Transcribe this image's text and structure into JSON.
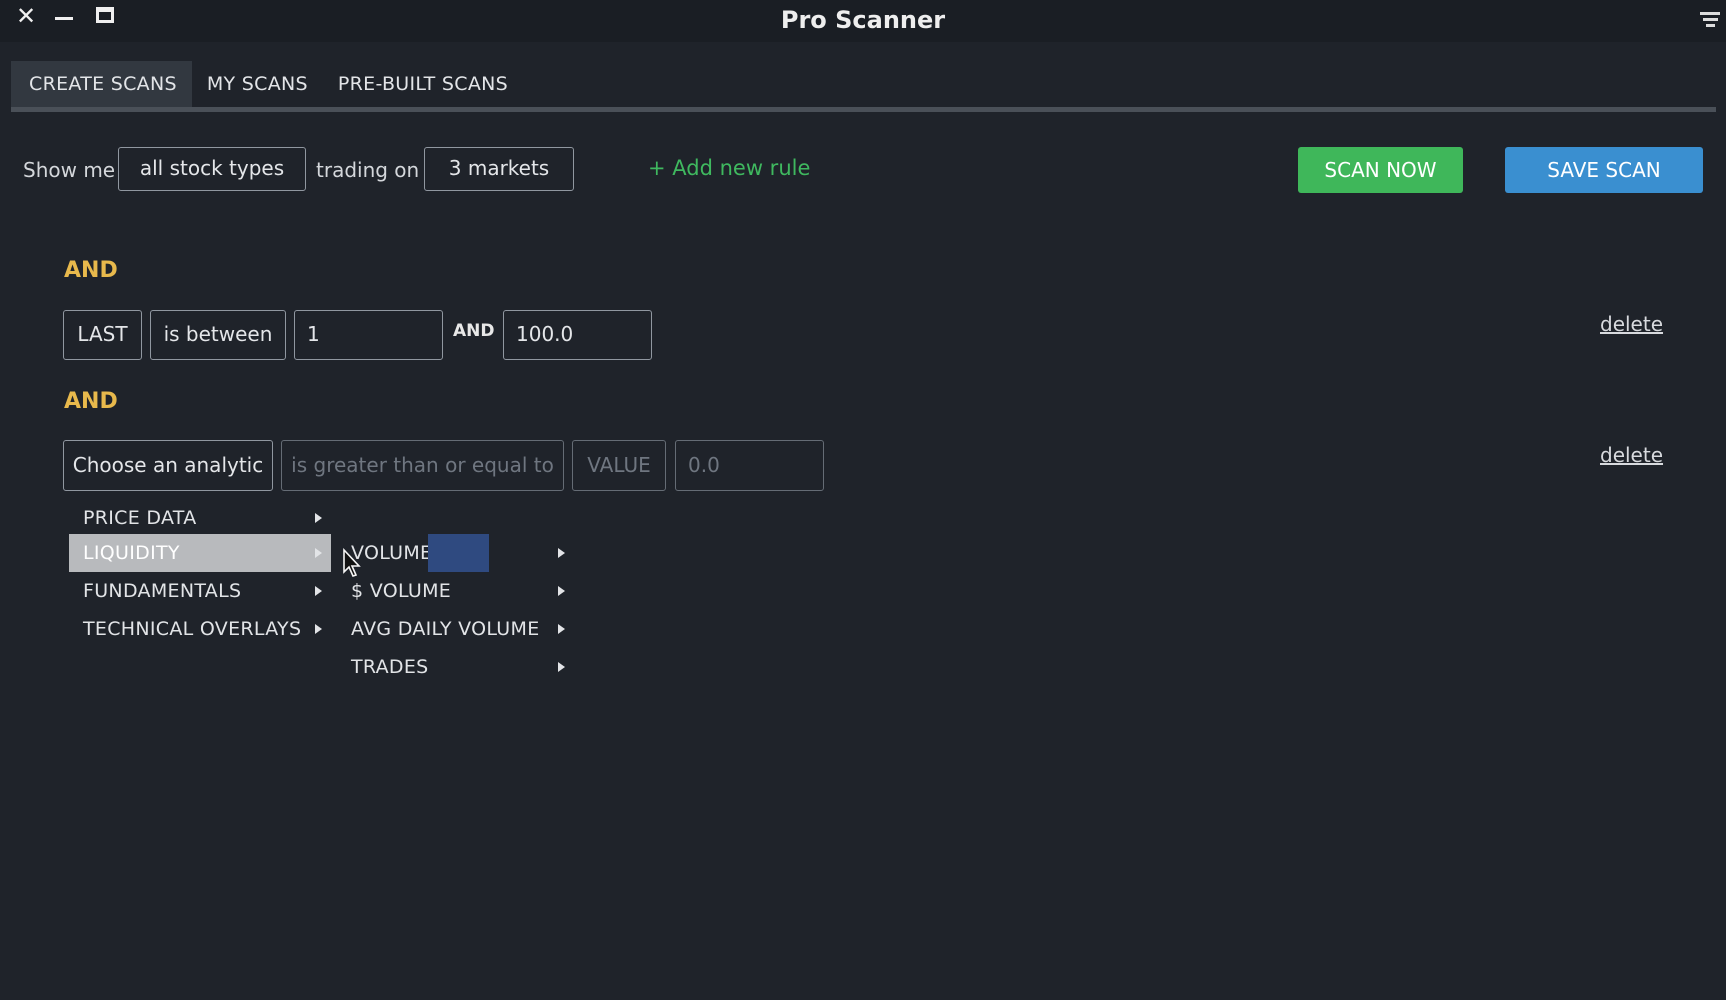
{
  "window": {
    "title": "Pro Scanner",
    "close_icon": "✕",
    "minimize_icon": "minimize-icon",
    "maximize_icon": "maximize-icon",
    "menu_icon": "hamburger-icon"
  },
  "tabs": [
    {
      "label": "CREATE SCANS",
      "active": true
    },
    {
      "label": "MY SCANS",
      "active": false
    },
    {
      "label": "PRE-BUILT SCANS",
      "active": false
    }
  ],
  "toolbar": {
    "show_me_label": "Show me",
    "stock_types_value": "all stock types",
    "trading_on_label": "trading on",
    "markets_value": "3 markets",
    "add_rule_label": "+ Add new rule",
    "scan_now_label": "SCAN NOW",
    "save_scan_label": "SAVE SCAN"
  },
  "rules": [
    {
      "connector": "AND",
      "analytic": "LAST",
      "operator": "is between",
      "value1": "1",
      "between_and": "AND",
      "value2": "100.0",
      "delete_label": "delete"
    },
    {
      "connector": "AND",
      "analytic": "Choose an analytic",
      "operator": "is greater than or equal to",
      "value_type": "VALUE",
      "value": "0.0",
      "delete_label": "delete"
    }
  ],
  "analytic_menu": {
    "categories": [
      {
        "label": "PRICE DATA",
        "highlighted": false
      },
      {
        "label": "LIQUIDITY",
        "highlighted": true
      },
      {
        "label": "FUNDAMENTALS",
        "highlighted": false
      },
      {
        "label": "TECHNICAL OVERLAYS",
        "highlighted": false
      }
    ],
    "liquidity_submenu": [
      {
        "label": "VOLUME"
      },
      {
        "label": "$ VOLUME"
      },
      {
        "label": "AVG DAILY VOLUME"
      },
      {
        "label": "TRADES"
      }
    ]
  },
  "colors": {
    "background": "#1f232a",
    "accent_green": "#3fb75a",
    "accent_blue": "#3a8fd0",
    "connector_gold": "#e8b94c",
    "menu_highlight": "#b8babd"
  }
}
